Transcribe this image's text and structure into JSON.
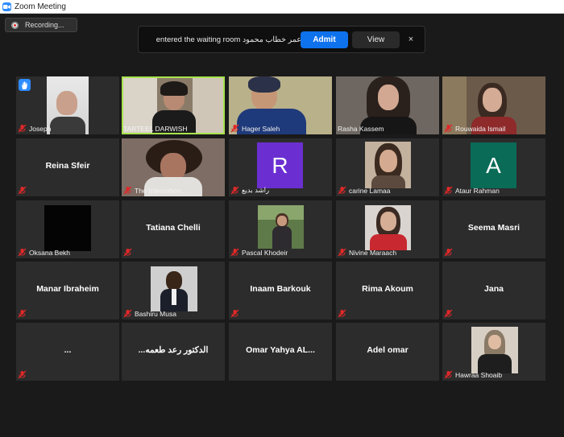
{
  "window": {
    "title": "Zoom Meeting"
  },
  "recording": {
    "label": "Recording..."
  },
  "waiting_notice": {
    "message": "عمر خطاب محمود entered the waiting room",
    "admit_label": "Admit",
    "view_label": "View",
    "close_glyph": "×"
  },
  "participants": [
    {
      "label": "Joseph",
      "hand_raised": true
    },
    {
      "label": "TARTEEL DARWISH",
      "active_speaker": true
    },
    {
      "label": "Hager Saleh"
    },
    {
      "label": "Rasha Kassem"
    },
    {
      "label": "Rouwaida Ismail"
    },
    {
      "name": "Reina Sfeir"
    },
    {
      "label": "The Internation..."
    },
    {
      "label": "راشد بديع",
      "avatar_letter": "R",
      "avatar_color": "#6b2fd1"
    },
    {
      "label": "carine Lamaa"
    },
    {
      "label": "Ataur Rahman",
      "avatar_letter": "A",
      "avatar_color": "#0a6b57"
    },
    {
      "label": "Oksana Bekh"
    },
    {
      "name": "Tatiana Chelli"
    },
    {
      "label": "Pascal Khodeir"
    },
    {
      "label": "Nivine Maraach"
    },
    {
      "name": "Seema Masri"
    },
    {
      "name": "Manar Ibraheim"
    },
    {
      "label": "Bashiru Musa"
    },
    {
      "name": "Inaam Barkouk"
    },
    {
      "name": "Rima Akoum"
    },
    {
      "name": "Jana"
    },
    {
      "name": "..."
    },
    {
      "name": "الدكتور رعد طعمه..."
    },
    {
      "name": "Omar Yahya AL..."
    },
    {
      "name": "Adel omar"
    },
    {
      "label": "Hawraa Shoaib"
    }
  ],
  "colors": {
    "admit": "#0e72ed",
    "active_border": "#a8e34d",
    "mute": "#e02828"
  }
}
